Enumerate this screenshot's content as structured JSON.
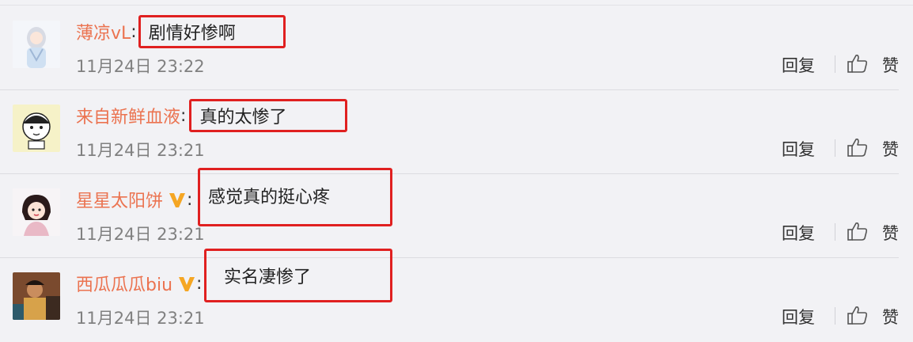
{
  "comments": [
    {
      "username": "薄凉vL",
      "verified": false,
      "colon": ":",
      "text": "剧情好惨啊",
      "time": "11月24日 23:22",
      "reply": "回复",
      "like": "赞"
    },
    {
      "username": "来自新鲜血液",
      "verified": false,
      "colon": ":",
      "text": "真的太惨了",
      "time": "11月24日 23:21",
      "reply": "回复",
      "like": "赞"
    },
    {
      "username": "星星太阳饼",
      "verified": true,
      "colon": ":",
      "text": "感觉真的挺心疼",
      "time": "11月24日 23:21",
      "reply": "回复",
      "like": "赞"
    },
    {
      "username": "西瓜瓜瓜biu",
      "verified": true,
      "colon": ":",
      "text": "实名凄惨了",
      "time": "11月24日 23:21",
      "reply": "回复",
      "like": "赞"
    }
  ],
  "colors": {
    "username": "#eb7350",
    "highlight_border": "#e02020",
    "verified_badge": "#f5a623",
    "timestamp": "#808080"
  },
  "icons": {
    "like": "thumbs-up-icon",
    "verified": "verified-v-icon"
  }
}
